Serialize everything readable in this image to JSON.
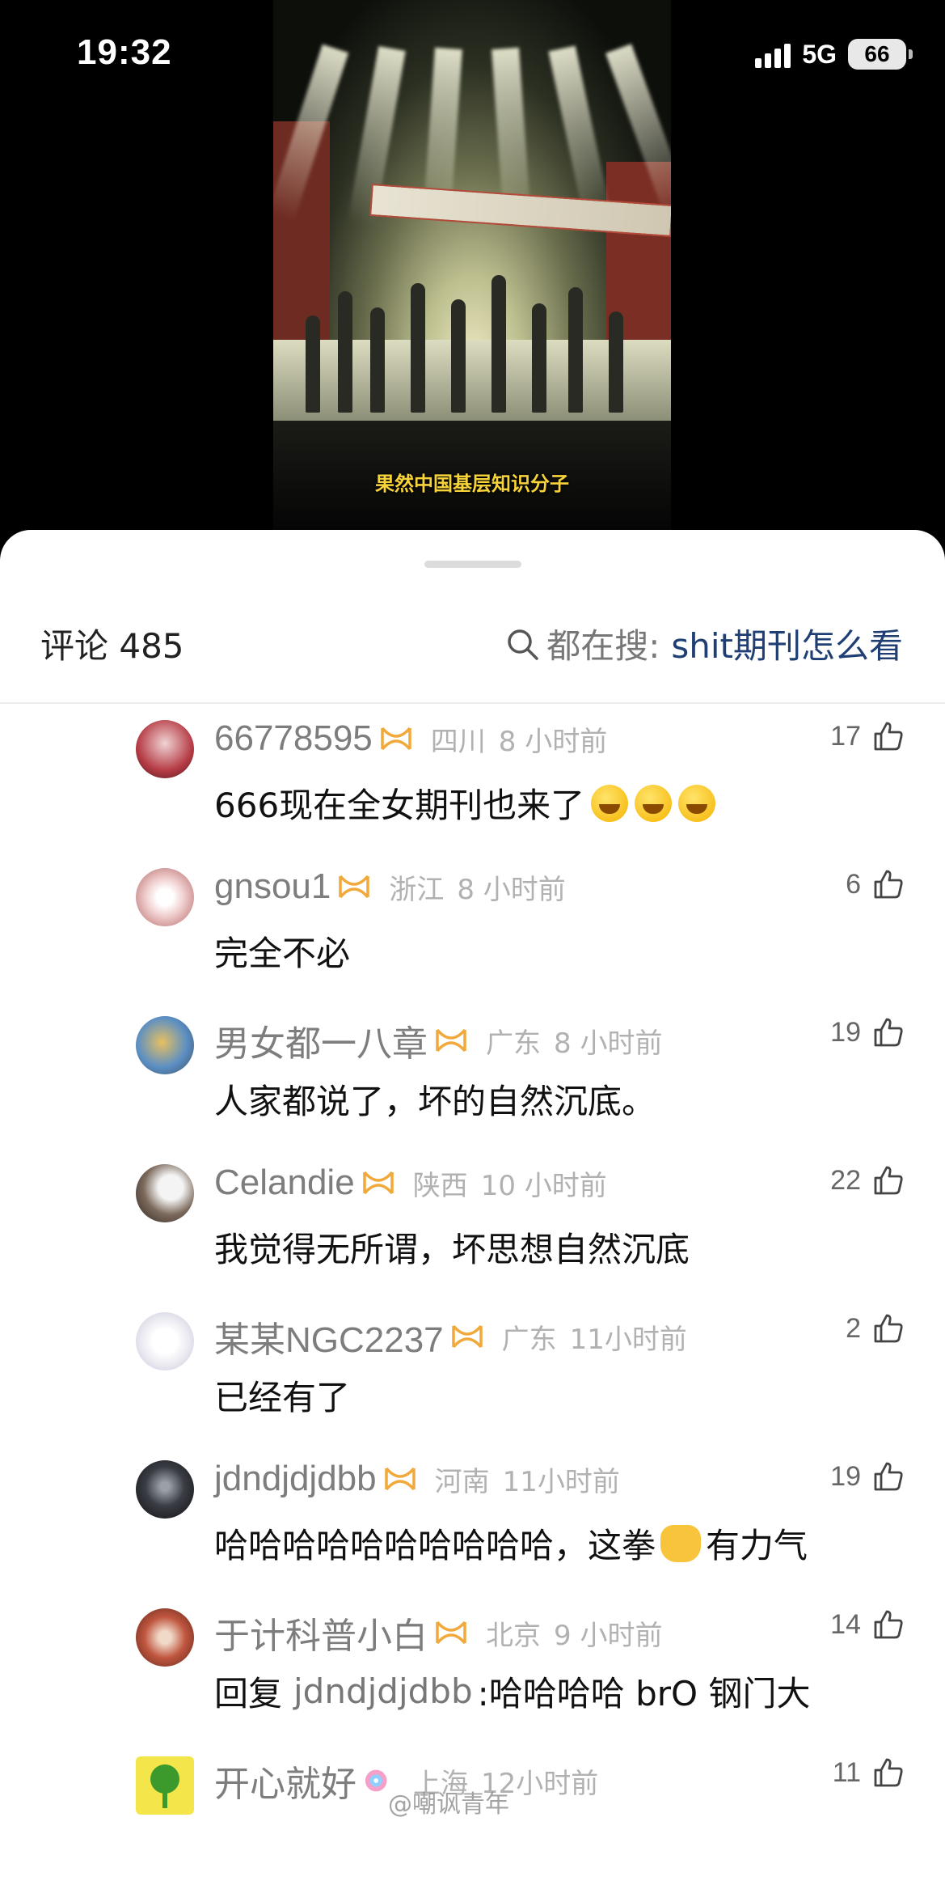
{
  "status_bar": {
    "time": "19:32",
    "network": "5G",
    "battery": "66"
  },
  "video": {
    "subtitle": "果然中国基层知识分子"
  },
  "comments_header": {
    "title": "评论 485",
    "search_prefix": "都在搜:",
    "search_keyword": "shit期刊怎么看"
  },
  "comments": [
    {
      "user": "66778595",
      "location": "四川",
      "time": "8 小时前",
      "likes": "17",
      "text": "666现在全女期刊也来了"
    },
    {
      "user": "gnsou1",
      "location": "浙江",
      "time": "8 小时前",
      "likes": "6",
      "text": "完全不必"
    },
    {
      "user": "男女都一八章",
      "location": "广东",
      "time": "8 小时前",
      "likes": "19",
      "text": "人家都说了，坏的自然沉底。"
    },
    {
      "user": "Celandie",
      "location": "陕西",
      "time": "10 小时前",
      "likes": "22",
      "text": "我觉得无所谓，坏思想自然沉底"
    },
    {
      "user": "某某NGC2237",
      "location": "广东",
      "time": "11小时前",
      "likes": "2",
      "text": "已经有了"
    },
    {
      "user": "jdndjdjdbb",
      "location": "河南",
      "time": "11小时前",
      "likes": "19",
      "text": "哈哈哈哈哈哈哈哈哈哈，这拳",
      "text_after": "有力气"
    },
    {
      "user": "于计科普小白",
      "location": "北京",
      "time": "9 小时前",
      "likes": "14",
      "reply_prefix": "回复",
      "reply_to": "jdndjdjdbb",
      "text": ":哈哈哈哈 brO 钢门大"
    },
    {
      "user": "开心就好",
      "location": "上海",
      "time": "12小时前",
      "likes": "11",
      "text": ""
    }
  ],
  "watermark": "@嘲讽青年",
  "colors": {
    "accent_link": "#1f3f74",
    "badge_orange": "#f2a93b"
  }
}
